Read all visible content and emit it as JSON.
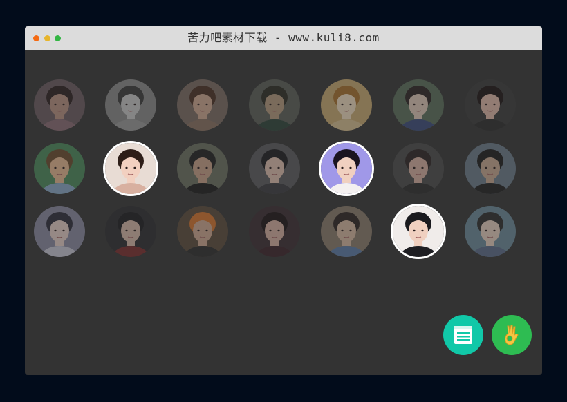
{
  "window": {
    "title": "苦力吧素材下载 - www.kuli8.com"
  },
  "avatars": [
    {
      "id": "a1",
      "selected": false,
      "bg": "#6b5a60",
      "skin": "#b89080",
      "hair": "#2a1e1e",
      "shirt": "#8a6a74"
    },
    {
      "id": "a2",
      "selected": false,
      "bg": "#8a8a8a",
      "skin": "#c8c8c8",
      "hair": "#3a3a3a",
      "shirt": "#9a9a9a"
    },
    {
      "id": "a3",
      "selected": false,
      "bg": "#7a6a62",
      "skin": "#d0a890",
      "hair": "#4a2e22",
      "shirt": "#8a7060"
    },
    {
      "id": "a4",
      "selected": false,
      "bg": "#5a5e56",
      "skin": "#b49a7c",
      "hair": "#2a2a22",
      "shirt": "#2a4238"
    },
    {
      "id": "a5",
      "selected": false,
      "bg": "#c8aa70",
      "skin": "#f0dcc0",
      "hair": "#a8702a",
      "shirt": "#d8c090"
    },
    {
      "id": "a6",
      "selected": false,
      "bg": "#5a6e5a",
      "skin": "#e0c8b8",
      "hair": "#2a2222",
      "shirt": "#3a4a7a"
    },
    {
      "id": "a7",
      "selected": false,
      "bg": "#3a3a3a",
      "skin": "#e0b8a8",
      "hair": "#1a1212",
      "shirt": "#2a2a2a"
    },
    {
      "id": "b1",
      "selected": false,
      "bg": "#4a8a5a",
      "skin": "#e8b890",
      "hair": "#6a4a2a",
      "shirt": "#8aa8c8"
    },
    {
      "id": "b2",
      "selected": true,
      "bg": "#e8dcd4",
      "skin": "#f2d0c0",
      "hair": "#2e1e18",
      "shirt": "#d8b0a0"
    },
    {
      "id": "b3",
      "selected": false,
      "bg": "#6a7060",
      "skin": "#c8a088",
      "hair": "#1e1e1e",
      "shirt": "#1a1a1a"
    },
    {
      "id": "b4",
      "selected": false,
      "bg": "#5a5a5e",
      "skin": "#e0c0b0",
      "hair": "#1a1a1e",
      "shirt": "#3a3a3e"
    },
    {
      "id": "b5",
      "selected": true,
      "bg": "#a098e8",
      "skin": "#f0d0c0",
      "hair": "#1a1420",
      "shirt": "#f4f0f0"
    },
    {
      "id": "b6",
      "selected": false,
      "bg": "#4a4a4a",
      "skin": "#d8b0a0",
      "hair": "#2a2222",
      "shirt": "#2a2a2a"
    },
    {
      "id": "b7",
      "selected": false,
      "bg": "#6a7a8a",
      "skin": "#c8a890",
      "hair": "#1a1a1a",
      "shirt": "#1e1e1e"
    },
    {
      "id": "c1",
      "selected": false,
      "bg": "#8a8aa0",
      "skin": "#e8d0c8",
      "hair": "#2a2a3a",
      "shirt": "#c8c8d8"
    },
    {
      "id": "c2",
      "selected": false,
      "bg": "#2a2a2e",
      "skin": "#d8b8a8",
      "hair": "#1a1a1e",
      "shirt": "#7a2a2a"
    },
    {
      "id": "c3",
      "selected": false,
      "bg": "#5a4a3a",
      "skin": "#d0a890",
      "hair": "#d8742a",
      "shirt": "#2a2a2a"
    },
    {
      "id": "c4",
      "selected": false,
      "bg": "#3a2a30",
      "skin": "#d8b0a0",
      "hair": "#1a1214",
      "shirt": "#3a2028"
    },
    {
      "id": "c5",
      "selected": false,
      "bg": "#8a7a6a",
      "skin": "#d8b8a0",
      "hair": "#2a2220",
      "shirt": "#5a7aa8"
    },
    {
      "id": "c6",
      "selected": true,
      "bg": "#f0ecea",
      "skin": "#f0d0c0",
      "hair": "#1a1a1e",
      "shirt": "#1e1e22"
    },
    {
      "id": "c7",
      "selected": false,
      "bg": "#6a8a9a",
      "skin": "#e8d0c0",
      "hair": "#2a2a2a",
      "shirt": "#5a6a8a"
    }
  ],
  "buttons": {
    "list_icon": "list-icon",
    "ok_icon": "ok-hand-icon",
    "list_color": "#11c8a8",
    "ok_color": "#2ebc52"
  }
}
